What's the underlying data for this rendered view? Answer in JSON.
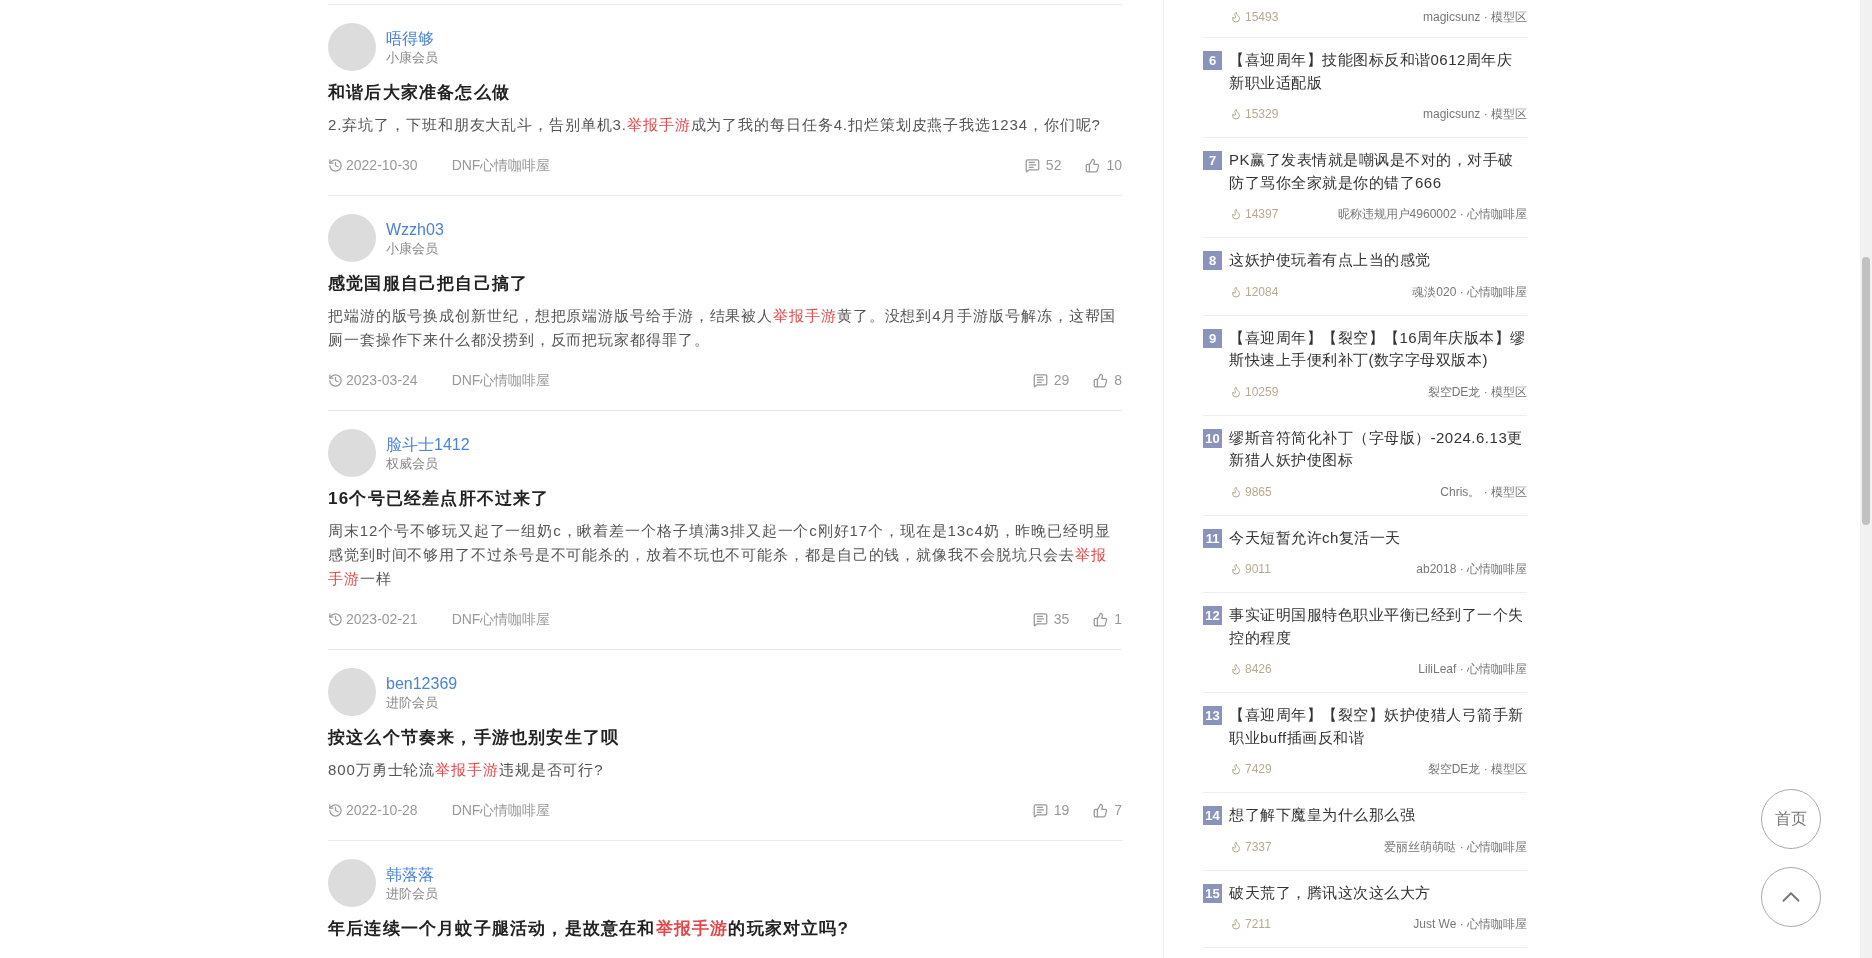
{
  "posts": [
    {
      "author": "唔得够",
      "tier": "小康会员",
      "title": [
        {
          "text": "和谐后大家准备怎么做",
          "highlight": false
        }
      ],
      "excerpt": [
        {
          "text": "2.弃坑了，下班和朋友大乱斗，告别单机3.",
          "highlight": false
        },
        {
          "text": "举报手游",
          "highlight": true
        },
        {
          "text": "成为了我的每日任务4.扣烂策划皮燕子我选1234，你们呢?",
          "highlight": false
        }
      ],
      "date": "2022-10-30",
      "forum": "DNF心情咖啡屋",
      "comments": "52",
      "likes": "10"
    },
    {
      "author": "Wzzh03",
      "tier": "小康会员",
      "title": [
        {
          "text": "感觉国服自己把自己搞了",
          "highlight": false
        }
      ],
      "excerpt": [
        {
          "text": "把端游的版号换成创新世纪，想把原端游版号给手游，结果被人",
          "highlight": false
        },
        {
          "text": "举报手游",
          "highlight": true
        },
        {
          "text": "黄了。没想到4月手游版号解冻，这帮国厕一套操作下来什么都没捞到，反而把玩家都得罪了。",
          "highlight": false
        }
      ],
      "date": "2023-03-24",
      "forum": "DNF心情咖啡屋",
      "comments": "29",
      "likes": "8"
    },
    {
      "author": "脸斗士1412",
      "tier": "权威会员",
      "title": [
        {
          "text": "16个号已经差点肝不过来了",
          "highlight": false
        }
      ],
      "excerpt": [
        {
          "text": "周末12个号不够玩又起了一组奶c，瞅着差一个格子填满3排又起一个c刚好17个，现在是13c4奶，昨晚已经明显感觉到时间不够用了不过杀号是不可能杀的，放着不玩也不可能杀，都是自己的钱，就像我不会脱坑只会去",
          "highlight": false
        },
        {
          "text": "举报手游",
          "highlight": true
        },
        {
          "text": "一样",
          "highlight": false
        }
      ],
      "date": "2023-02-21",
      "forum": "DNF心情咖啡屋",
      "comments": "35",
      "likes": "1"
    },
    {
      "author": "ben12369",
      "tier": "进阶会员",
      "title": [
        {
          "text": "按这么个节奏来，手游也别安生了呗",
          "highlight": false
        }
      ],
      "excerpt": [
        {
          "text": "800万勇士轮流",
          "highlight": false
        },
        {
          "text": "举报手游",
          "highlight": true
        },
        {
          "text": "违规是否可行?",
          "highlight": false
        }
      ],
      "date": "2022-10-28",
      "forum": "DNF心情咖啡屋",
      "comments": "19",
      "likes": "7"
    },
    {
      "author": "韩落落",
      "tier": "进阶会员",
      "title": [
        {
          "text": "年后连续一个月蚊子腿活动，是故意在和",
          "highlight": false
        },
        {
          "text": "举报手游",
          "highlight": true
        },
        {
          "text": "的玩家对立吗?",
          "highlight": false
        }
      ]
    }
  ],
  "ranking": {
    "top_meta": {
      "views": "15493",
      "source": "magicsunz · 模型区"
    },
    "items": [
      {
        "rank": "6",
        "title": "【喜迎周年】技能图标反和谐0612周年庆新职业适配版",
        "views": "15329",
        "source": "magicsunz · 模型区"
      },
      {
        "rank": "7",
        "title": "PK赢了发表情就是嘲讽是不对的，对手破防了骂你全家就是你的错了666",
        "views": "14397",
        "source": "昵称违规用户4960002 · 心情咖啡屋"
      },
      {
        "rank": "8",
        "title": "这妖护使玩着有点上当的感觉",
        "views": "12084",
        "source": "魂淡020 · 心情咖啡屋"
      },
      {
        "rank": "9",
        "title": "【喜迎周年】【裂空】【16周年庆版本】缪斯快速上手便利补丁(数字字母双版本)",
        "views": "10259",
        "source": "裂空DE龙 · 模型区"
      },
      {
        "rank": "10",
        "title": "缪斯音符简化补丁（字母版）-2024.6.13更新猎人妖护使图标",
        "views": "9865",
        "source": "Chris。 · 模型区"
      },
      {
        "rank": "11",
        "title": "今天短暂允许ch复活一天",
        "views": "9011",
        "source": "ab2018 · 心情咖啡屋"
      },
      {
        "rank": "12",
        "title": "事实证明国服特色职业平衡已经到了一个失控的程度",
        "views": "8426",
        "source": "LiliLeaf · 心情咖啡屋"
      },
      {
        "rank": "13",
        "title": "【喜迎周年】【裂空】妖护使猎人弓箭手新职业buff插画反和谐",
        "views": "7429",
        "source": "裂空DE龙 · 模型区"
      },
      {
        "rank": "14",
        "title": "想了解下魔皇为什么那么强",
        "views": "7337",
        "source": "爱丽丝萌萌哒 · 心情咖啡屋"
      },
      {
        "rank": "15",
        "title": "破天荒了，腾讯这次这么大方",
        "views": "7211",
        "source": "Just We · 心情咖啡屋"
      }
    ]
  },
  "floating": {
    "home_label": "首页"
  }
}
